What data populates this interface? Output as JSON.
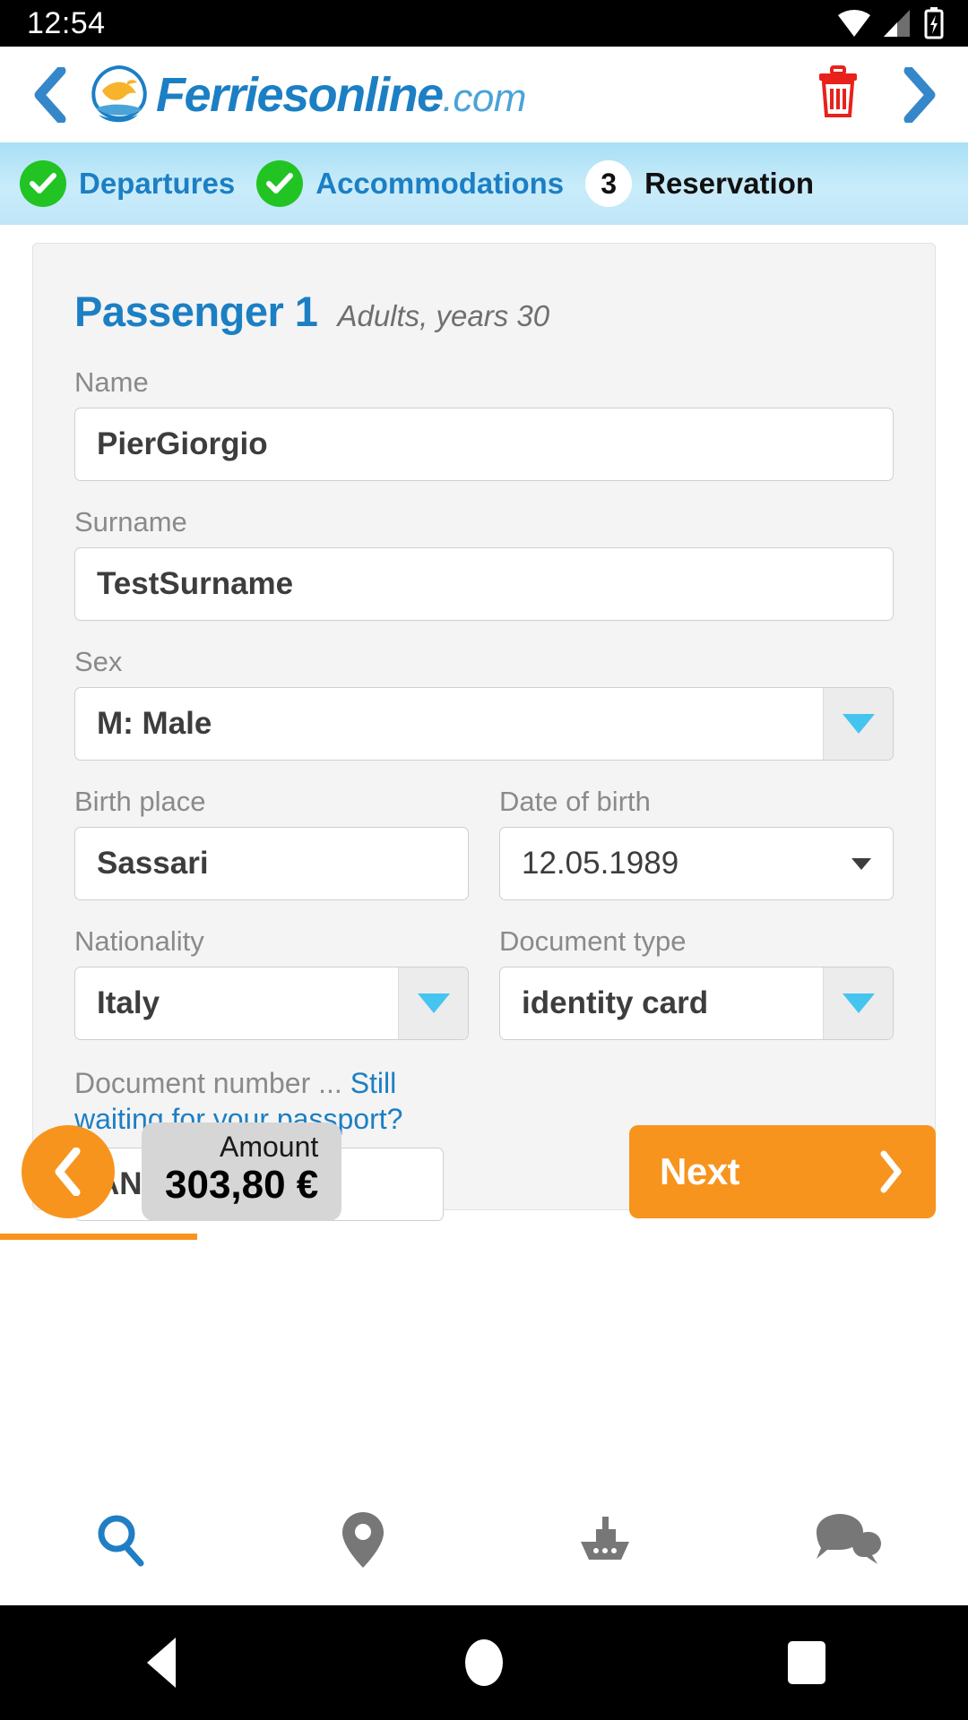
{
  "status_bar": {
    "time": "12:54",
    "icons": [
      "wifi-icon",
      "signal-icon",
      "battery-charging-icon"
    ]
  },
  "header": {
    "back_icon": "chevron-left-icon",
    "forward_icon": "chevron-right-icon",
    "delete_icon": "trash-icon",
    "brand_name": "Ferriesonline",
    "brand_tld": ".com",
    "logo_icon": "dolphin-wave-logo"
  },
  "steps": [
    {
      "label": "Departures",
      "state": "done",
      "marker": "check-icon"
    },
    {
      "label": "Accommodations",
      "state": "done",
      "marker": "check-icon"
    },
    {
      "label": "Reservation",
      "state": "current",
      "marker": "3"
    }
  ],
  "passenger": {
    "title": "Passenger 1",
    "subtitle": "Adults, years 30",
    "fields": {
      "name_label": "Name",
      "name_value": "PierGiorgio",
      "surname_label": "Surname",
      "surname_value": "TestSurname",
      "sex_label": "Sex",
      "sex_value": "M: Male",
      "birth_place_label": "Birth place",
      "birth_place_value": "Sassari",
      "date_of_birth_label": "Date of birth",
      "date_of_birth_value": "12.05.1989",
      "nationality_label": "Nationality",
      "nationality_value": "Italy",
      "document_type_label": "Document type",
      "document_type_value": "identity card",
      "document_number_label": "Document number ... ",
      "document_number_link": "Still waiting for your passport?",
      "document_number_value": "AN94739787"
    }
  },
  "action_bar": {
    "back_icon": "chevron-left-icon",
    "amount_label": "Amount",
    "amount_value": "303,80 €",
    "next_label": "Next",
    "next_icon": "chevron-right-icon"
  },
  "tab_bar": {
    "tabs": [
      {
        "name": "search",
        "icon": "search-icon",
        "active": true
      },
      {
        "name": "map",
        "icon": "location-pin-icon",
        "active": false
      },
      {
        "name": "ferries",
        "icon": "ship-icon",
        "active": false
      },
      {
        "name": "chat",
        "icon": "chat-bubbles-icon",
        "active": false
      }
    ]
  },
  "android_nav": {
    "back": "triangle-back-icon",
    "home": "circle-home-icon",
    "recents": "square-recents-icon"
  },
  "colors": {
    "brand_blue": "#1c7fc4",
    "accent_orange": "#f7941e",
    "step_green": "#22c424",
    "dropdown_arrow": "#45c4f0",
    "delete_red": "#e8211a"
  }
}
